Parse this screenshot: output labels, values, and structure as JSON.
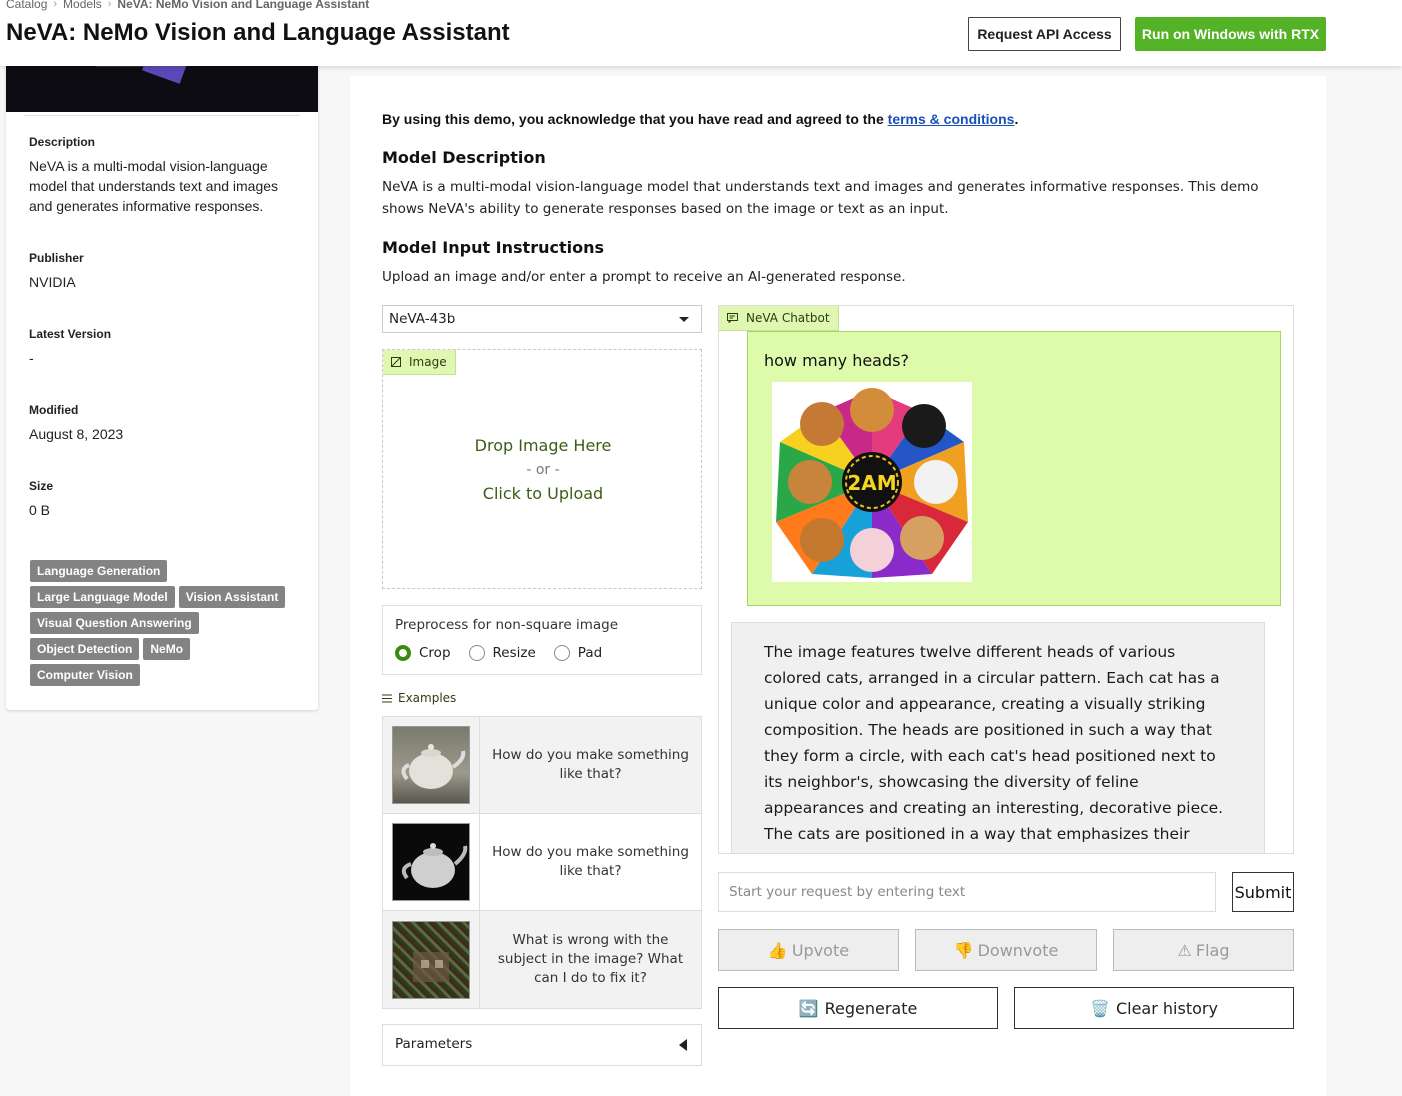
{
  "breadcrumb": [
    "Catalog",
    "Models",
    "NeVA: NeMo Vision and Language Assistant"
  ],
  "page_title": "NeVA: NeMo Vision and Language Assistant",
  "header_buttons": {
    "api": "Request API Access",
    "rtx": "Run on Windows with RTX"
  },
  "colors": {
    "accent_green": "#54b226",
    "chat_tab_bg": "#dff7b1",
    "user_msg_bg": "#defaab",
    "link": "#1a4fb8"
  },
  "sidebar": {
    "description_label": "Description",
    "description": "NeVA is a multi-modal vision-language model that understands text and images and generates informative responses.",
    "publisher_label": "Publisher",
    "publisher": "NVIDIA",
    "latest_version_label": "Latest Version",
    "latest_version": "-",
    "modified_label": "Modified",
    "modified": "August 8, 2023",
    "size_label": "Size",
    "size": "0 B",
    "tags": [
      "Language Generation",
      "Large Language Model",
      "Vision Assistant",
      "Visual Question Answering",
      "Object Detection",
      "NeMo",
      "Computer Vision"
    ]
  },
  "main": {
    "ack_prefix": "By using this demo, you acknowledge that you have read and agreed to the ",
    "ack_link": "terms & conditions",
    "ack_suffix": ".",
    "model_description_heading": "Model Description",
    "model_description": "NeVA is a multi-modal vision-language model that understands text and images and generates informative responses. This demo shows NeVA's ability to generate responses based on the image or text as an input.",
    "input_heading": "Model Input Instructions",
    "input_text": "Upload an image and/or enter a prompt to receive an AI-generated response.",
    "model_select": "NeVA-43b",
    "image_tab": "Image",
    "drop_here": "Drop Image Here",
    "drop_or": "- or -",
    "click_upload": "Click to Upload",
    "preprocess_label": "Preprocess for non-square image",
    "preprocess_options": [
      "Crop",
      "Resize",
      "Pad"
    ],
    "preprocess_selected": "Crop",
    "examples_label": "Examples",
    "examples": [
      "How do you make something like that?",
      "How do you make something like that?",
      "What is wrong with the subject in the image? What can I do to fix it?"
    ],
    "parameters": "Parameters"
  },
  "chat": {
    "tab": "NeVA Chatbot",
    "user_message": "how many heads?",
    "image_logo_text": "2AM",
    "bot_message": "The image features twelve different heads of various colored cats, arranged in a circular pattern. Each cat has a unique color and appearance, creating a visually striking composition. The heads are positioned in such a way that they form a circle, with each cat's head positioned next to its neighbor's, showcasing the diversity of feline appearances and creating an interesting, decorative piece. The cats are positioned in a way that emphasizes their distinct features and colors, making it an",
    "input_placeholder": "Start your request by entering text",
    "submit": "Submit",
    "upvote": "Upvote",
    "downvote": "Downvote",
    "flag": "Flag",
    "regenerate": "Regenerate",
    "clear_history": "Clear history"
  }
}
